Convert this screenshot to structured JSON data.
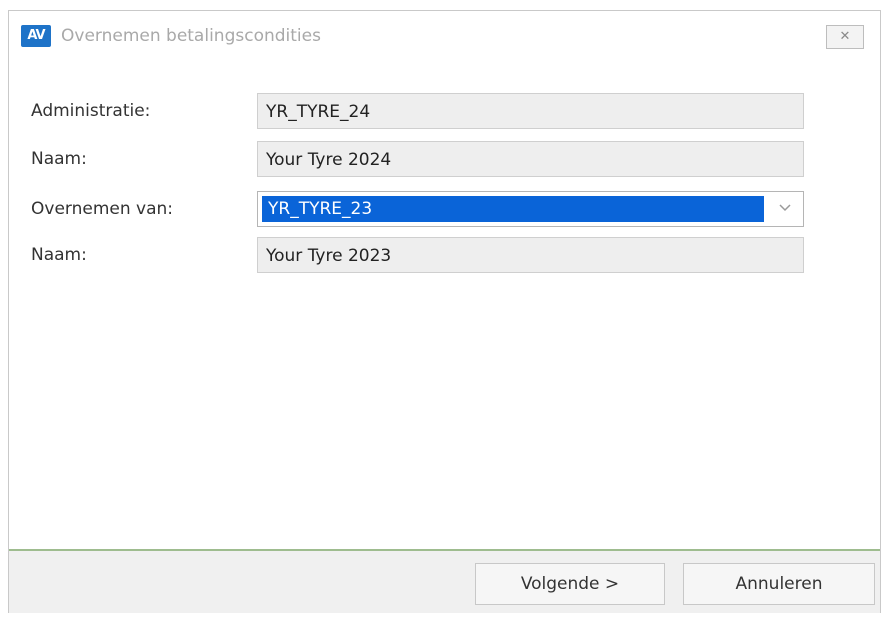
{
  "window": {
    "title": "Overnemen betalingscondities",
    "icon_text": "AV",
    "close_glyph": "✕"
  },
  "form": {
    "administratie": {
      "label": "Administratie:",
      "value": "YR_TYRE_24"
    },
    "naam_current": {
      "label": "Naam:",
      "value": "Your Tyre 2024"
    },
    "overnemen_van": {
      "label": "Overnemen van:",
      "value": "YR_TYRE_23"
    },
    "naam_source": {
      "label": "Naam:",
      "value": "Your Tyre 2023"
    }
  },
  "buttons": {
    "next_label": "Volgende >",
    "cancel_label": "Annuleren"
  },
  "colors": {
    "accent": "#1e73c8",
    "selection": "#0a64d8",
    "readonly_field": "#eeeeee",
    "footer_line": "#9ebc8f"
  },
  "icons": {
    "app": "av-app-icon",
    "close": "close-icon",
    "dropdown": "chevron-down-icon"
  }
}
